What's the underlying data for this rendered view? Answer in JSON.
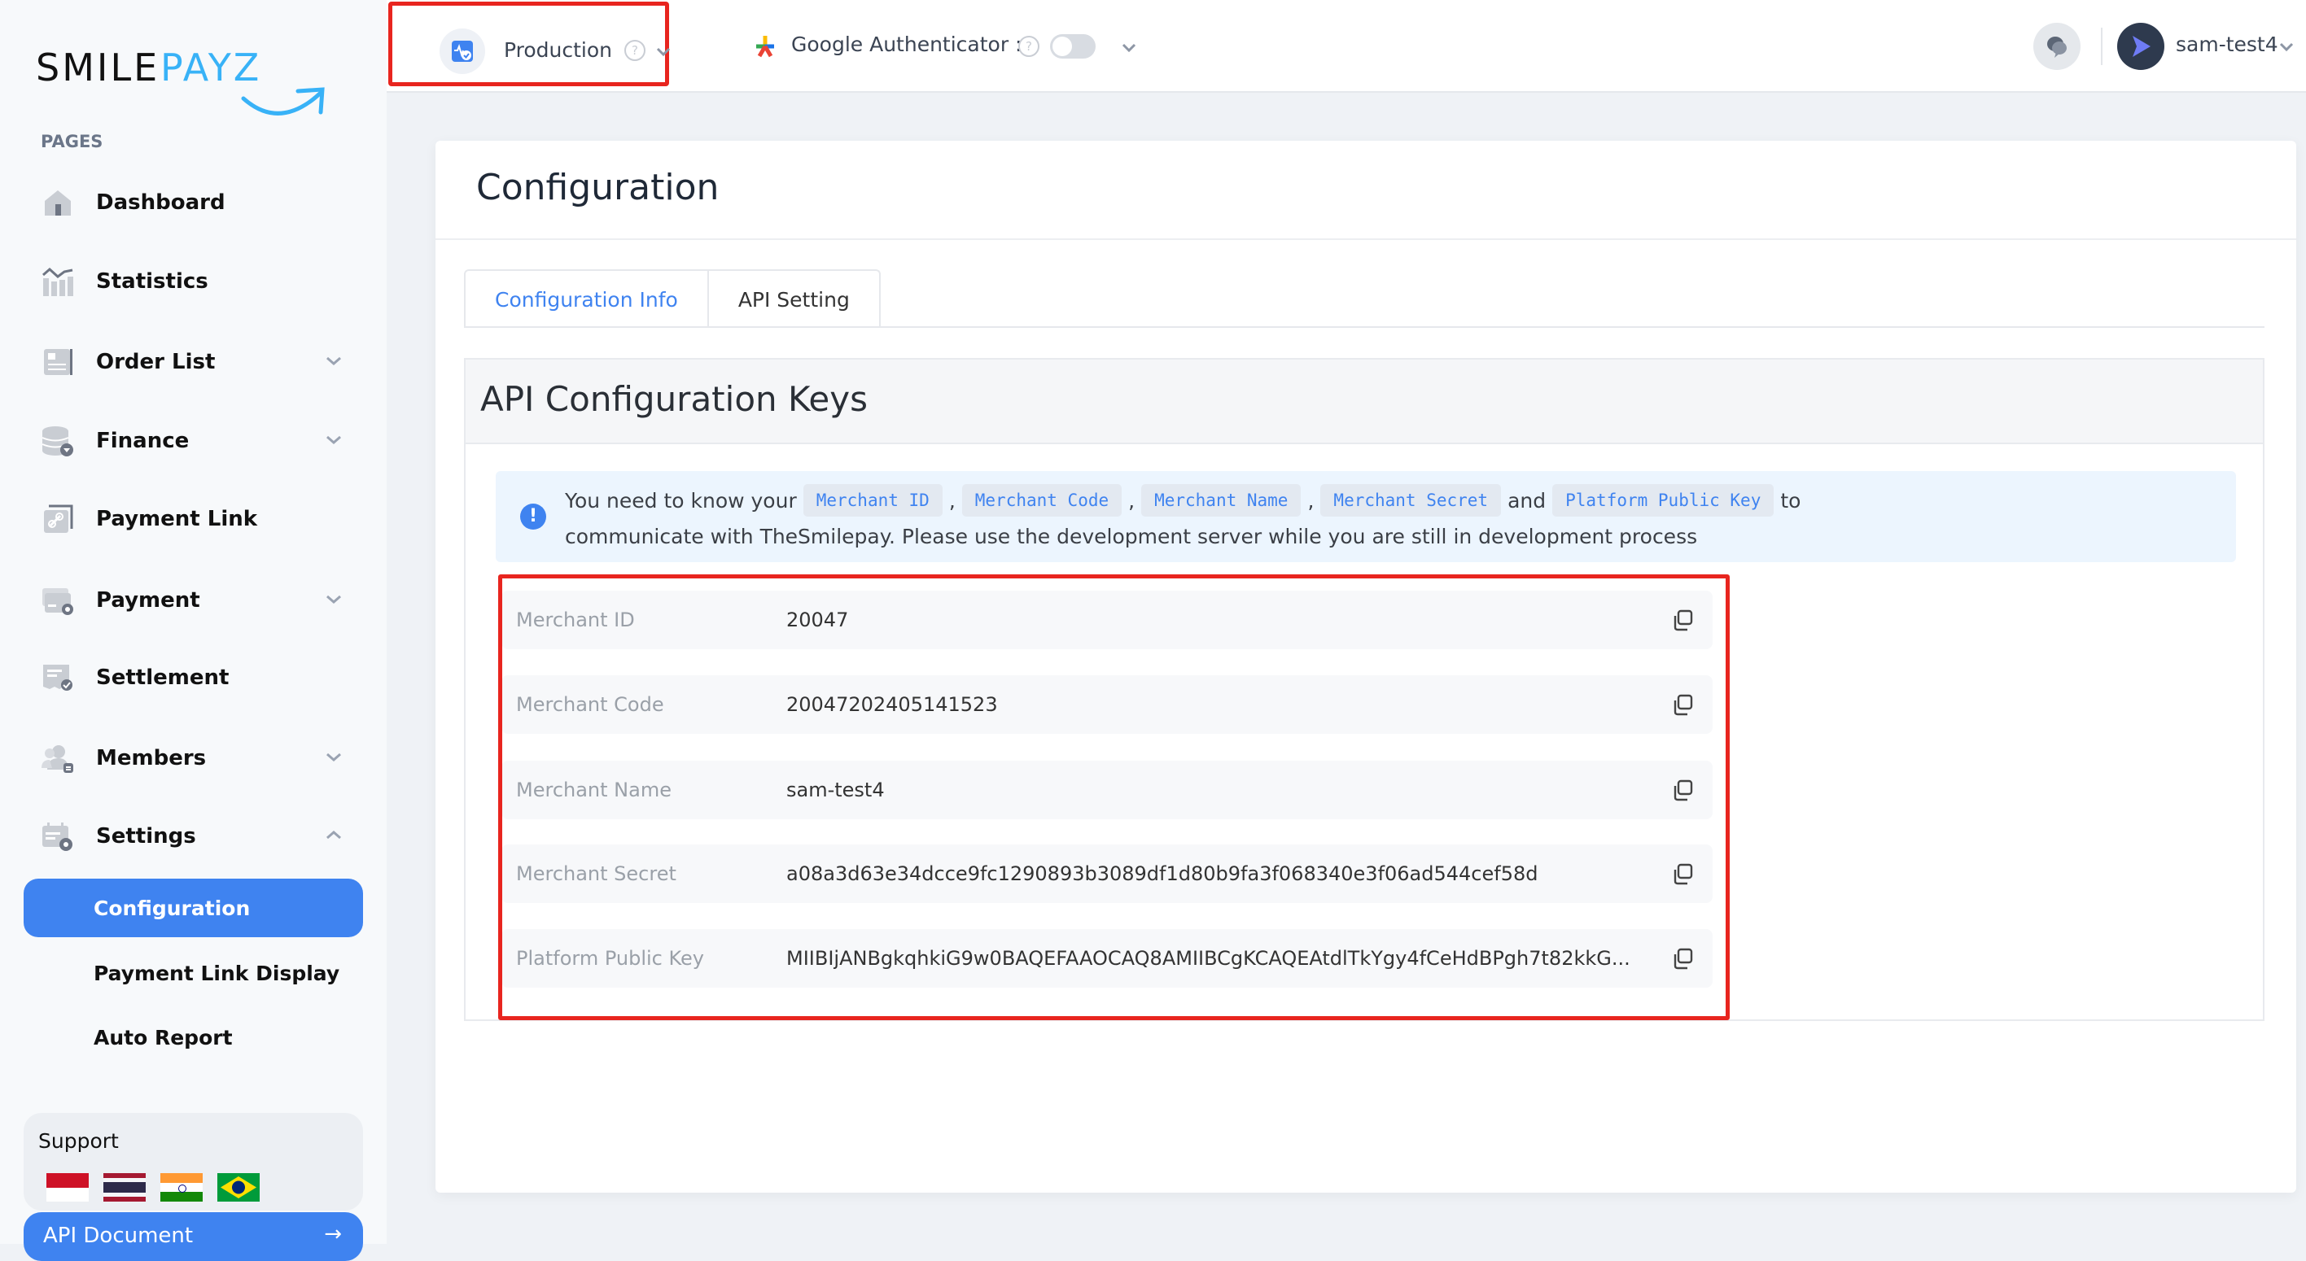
{
  "brand": {
    "part1": "SMILE",
    "part2": "PAYZ"
  },
  "sidebar": {
    "section_label": "PAGES",
    "items": [
      {
        "label": "Dashboard",
        "icon": "home-icon",
        "expandable": false
      },
      {
        "label": "Statistics",
        "icon": "chart-icon",
        "expandable": false
      },
      {
        "label": "Order List",
        "icon": "order-list-icon",
        "expandable": true
      },
      {
        "label": "Finance",
        "icon": "finance-database-icon",
        "expandable": true
      },
      {
        "label": "Payment Link",
        "icon": "payment-link-icon",
        "expandable": false
      },
      {
        "label": "Payment",
        "icon": "payment-card-settings-icon",
        "expandable": true
      },
      {
        "label": "Settlement",
        "icon": "settlement-receipt-icon",
        "expandable": false
      },
      {
        "label": "Members",
        "icon": "members-icon",
        "expandable": true
      },
      {
        "label": "Settings",
        "icon": "settings-calendar-icon",
        "expandable": true,
        "expanded": true
      }
    ],
    "settings_subitems": [
      {
        "label": "Configuration",
        "active": true
      },
      {
        "label": "Payment Link Display",
        "active": false
      },
      {
        "label": "Auto Report",
        "active": false
      }
    ],
    "support": {
      "title": "Support",
      "flags": [
        "indonesia-flag",
        "thailand-flag",
        "india-flag",
        "brazil-flag"
      ]
    },
    "api_document": {
      "label": "API Document",
      "icon": "arrow-right-icon"
    }
  },
  "topbar": {
    "environment": {
      "label": "Production",
      "icon": "environment-check-icon"
    },
    "google_auth": {
      "label": "Google Authenticator :",
      "enabled": false
    },
    "user": {
      "name": "sam-test4"
    }
  },
  "page": {
    "title": "Configuration",
    "tabs": [
      {
        "label": "Configuration Info",
        "active": true
      },
      {
        "label": "API Setting",
        "active": false
      }
    ],
    "section_title": "API Configuration Keys",
    "alert": {
      "prefix": "You need to know your",
      "codes": [
        "Merchant ID",
        "Merchant Code",
        "Merchant Name",
        "Merchant Secret",
        "Platform Public Key"
      ],
      "sep": ",",
      "and": "and",
      "suffix": "to",
      "line2": "communicate with TheSmilepay. Please use the development server while you are still in development process"
    },
    "keys": [
      {
        "label": "Merchant ID",
        "value": "20047"
      },
      {
        "label": "Merchant Code",
        "value": "20047202405141523"
      },
      {
        "label": "Merchant Name",
        "value": "sam-test4"
      },
      {
        "label": "Merchant Secret",
        "value": "a08a3d63e34dcce9fc1290893b3089df1d80b9fa3f068340e3f06ad544cef58d"
      },
      {
        "label": "Platform Public Key",
        "value": "MIIBIjANBgkqhkiG9w0BAQEFAAOCAQ8AMIIBCgKCAQEAtdlTkYgy4fCeHdBPgh7t82kkG..."
      }
    ]
  },
  "colors": {
    "accent": "#3f83f0",
    "highlight_border": "#e8251f",
    "logo_blue": "#38b2f7"
  }
}
